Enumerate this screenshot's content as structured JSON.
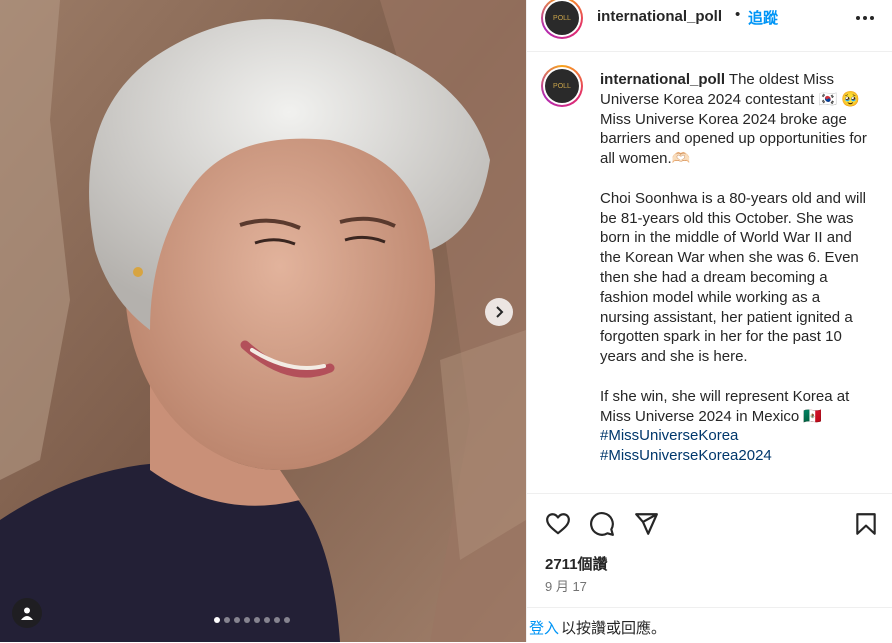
{
  "post": {
    "username": "international_poll",
    "follow_label": "追蹤",
    "separator": "•",
    "avatar_text": "POLL"
  },
  "caption": {
    "username": "international_poll",
    "text": " The oldest Miss Universe Korea 2024 contestant 🇰🇷 🥹 Miss Universe Korea 2024 broke age barriers and opened up opportunities for all women.🫶🏻\n\nChoi Soonhwa is a 80-years old and will be 81-years old this October. She was born in the middle of World War II and the Korean War when she was 6. Even then she had a dream becoming a fashion model while working as a nursing assistant, her patient ignited a forgotten spark in her for the past 10 years and she is here.\n\nIf she win, she will represent Korea at Miss Universe 2024 in Mexico 🇲🇽\n",
    "hashtags": [
      "#MissUniverseKorea",
      "#MissUniverseKorea2024"
    ]
  },
  "stats": {
    "likes": "2711個讚",
    "date": "9 月 17"
  },
  "login": {
    "link": "登入",
    "rest": "以按讚或回應。"
  },
  "carousel": {
    "total": 8,
    "active_index": 0
  },
  "icons": {
    "like": "heart-icon",
    "comment": "comment-icon",
    "share": "send-icon",
    "save": "bookmark-icon",
    "more": "more-icon",
    "next": "chevron-right-icon",
    "tag": "user-icon"
  },
  "colors": {
    "accent": "#0095f6",
    "hashtag": "#00376b",
    "text": "#262626",
    "secondary": "#737373"
  }
}
